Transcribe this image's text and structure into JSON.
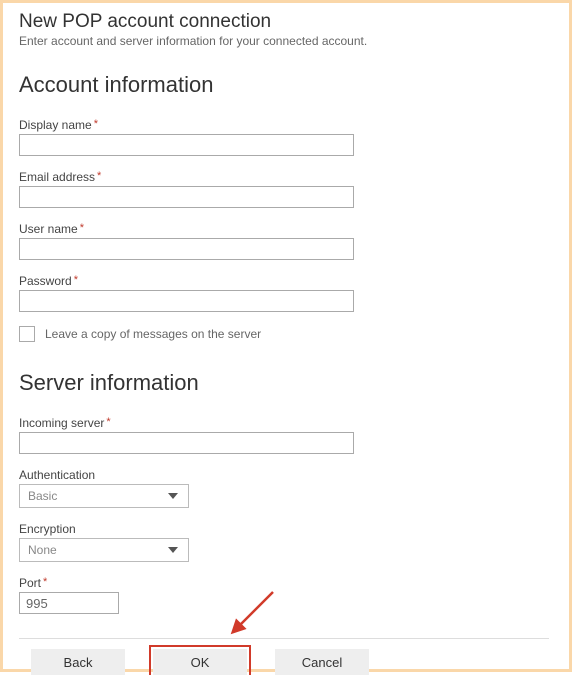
{
  "header": {
    "title": "New POP account connection",
    "subtitle": "Enter account and server information for your connected account."
  },
  "sections": {
    "account": {
      "heading": "Account information",
      "displayName": {
        "label": "Display name",
        "value": ""
      },
      "emailAddress": {
        "label": "Email address",
        "value": ""
      },
      "userName": {
        "label": "User name",
        "value": ""
      },
      "password": {
        "label": "Password",
        "value": ""
      },
      "leaveCopy": {
        "label": "Leave a copy of messages on the server",
        "checked": false
      }
    },
    "server": {
      "heading": "Server information",
      "incomingServer": {
        "label": "Incoming server",
        "value": ""
      },
      "authentication": {
        "label": "Authentication",
        "value": "Basic"
      },
      "encryption": {
        "label": "Encryption",
        "value": "None"
      },
      "port": {
        "label": "Port",
        "value": "995"
      }
    }
  },
  "buttons": {
    "back": "Back",
    "ok": "OK",
    "cancel": "Cancel"
  },
  "colors": {
    "frameAccent": "#fad7a9",
    "highlight": "#d13a2a",
    "required": "#c0392b"
  }
}
